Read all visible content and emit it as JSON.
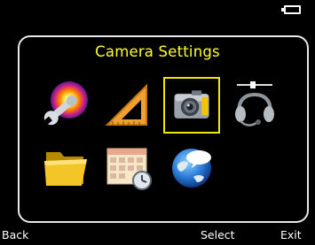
{
  "screen": {
    "title": "Camera Settings"
  },
  "status_bar": {
    "battery_icon": "battery-icon"
  },
  "menu": {
    "items": [
      {
        "id": "calibration",
        "icon": "wrench-thermal-icon",
        "selected": false
      },
      {
        "id": "measurement",
        "icon": "set-square-icon",
        "selected": false
      },
      {
        "id": "camera",
        "icon": "camera-icon",
        "selected": true
      },
      {
        "id": "audio",
        "icon": "headset-slider-icon",
        "selected": false
      },
      {
        "id": "files",
        "icon": "folder-icon",
        "selected": false
      },
      {
        "id": "calendar",
        "icon": "calendar-clock-icon",
        "selected": false
      },
      {
        "id": "language",
        "icon": "globe-speech-icon",
        "selected": false
      }
    ]
  },
  "softkeys": {
    "left": "Back",
    "center": "Select",
    "right": "Exit"
  },
  "colors": {
    "title": "#ffff33",
    "selection": "#f0e800",
    "frame": "#e8e8e8",
    "background": "#000000"
  }
}
